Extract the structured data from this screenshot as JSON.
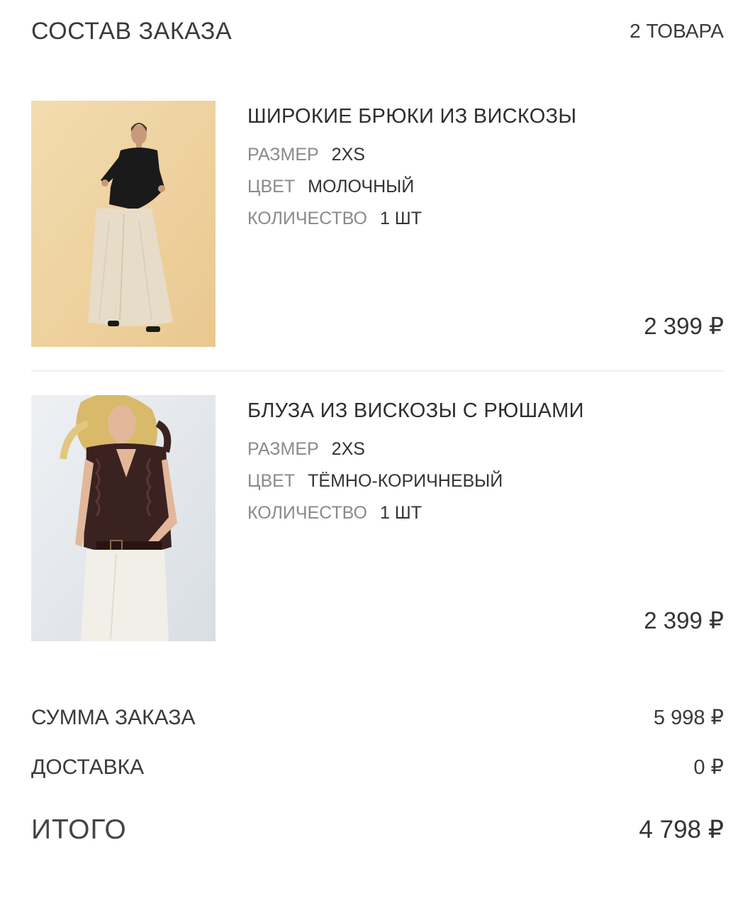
{
  "header": {
    "title": "СОСТАВ ЗАКАЗА",
    "count": "2 ТОВАРА"
  },
  "items": [
    {
      "name": "ШИРОКИЕ БРЮКИ ИЗ ВИСКОЗЫ",
      "size_label": "РАЗМЕР",
      "size": "2XS",
      "color_label": "ЦВЕТ",
      "color": "МОЛОЧНЫЙ",
      "qty_label": "КОЛИЧЕСТВО",
      "qty": "1 ШТ",
      "price": "2 399 ₽"
    },
    {
      "name": "БЛУЗА ИЗ ВИСКОЗЫ С РЮШАМИ",
      "size_label": "РАЗМЕР",
      "size": "2XS",
      "color_label": "ЦВЕТ",
      "color": "ТЁМНО-КОРИЧНЕВЫЙ",
      "qty_label": "КОЛИЧЕСТВО",
      "qty": "1 ШТ",
      "price": "2 399 ₽"
    }
  ],
  "summary": {
    "subtotal_label": "СУММА ЗАКАЗА",
    "subtotal": "5 998 ₽",
    "delivery_label": "ДОСТАВКА",
    "delivery": "0 ₽",
    "total_label": "ИТОГО",
    "total": "4 798 ₽"
  },
  "colors": {
    "photo1_bg": "#f0d6a8",
    "photo2_bg": "#e4e8ec",
    "blouse": "#3a2220",
    "trousers": "#e7dcc8",
    "divider": "#eeeeee"
  }
}
